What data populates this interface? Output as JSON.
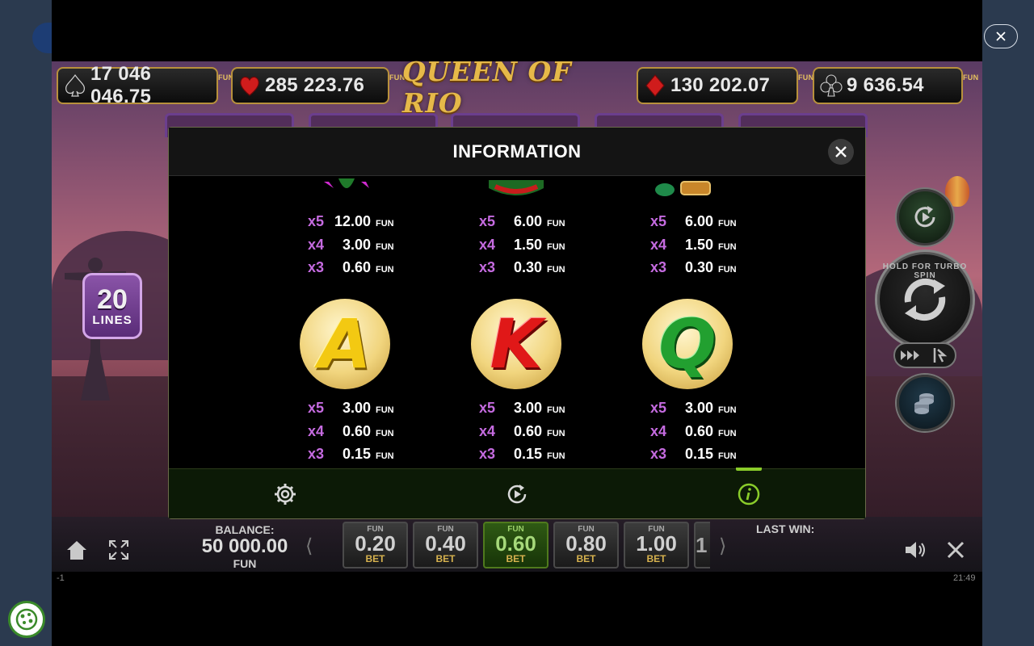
{
  "jackpots": [
    {
      "suit": "spade",
      "value": "17 046 046.75",
      "unit": "FUN"
    },
    {
      "suit": "heart",
      "value": "285 223.76",
      "unit": "FUN"
    },
    {
      "suit": "diamond",
      "value": "130 202.07",
      "unit": "FUN"
    },
    {
      "suit": "club",
      "value": "9 636.54",
      "unit": "FUN"
    }
  ],
  "logo": "QUEEN OF RIO",
  "lines": {
    "count": "20",
    "label": "LINES"
  },
  "dialog": {
    "title": "INFORMATION",
    "top_rows": [
      [
        {
          "m": "x5",
          "v": "12.00",
          "u": "FUN"
        },
        {
          "m": "x4",
          "v": "3.00",
          "u": "FUN"
        },
        {
          "m": "x3",
          "v": "0.60",
          "u": "FUN"
        }
      ],
      [
        {
          "m": "x5",
          "v": "6.00",
          "u": "FUN"
        },
        {
          "m": "x4",
          "v": "1.50",
          "u": "FUN"
        },
        {
          "m": "x3",
          "v": "0.30",
          "u": "FUN"
        }
      ],
      [
        {
          "m": "x5",
          "v": "6.00",
          "u": "FUN"
        },
        {
          "m": "x4",
          "v": "1.50",
          "u": "FUN"
        },
        {
          "m": "x3",
          "v": "0.30",
          "u": "FUN"
        }
      ]
    ],
    "symbols": [
      {
        "letter": "A",
        "pays": [
          {
            "m": "x5",
            "v": "3.00",
            "u": "FUN"
          },
          {
            "m": "x4",
            "v": "0.60",
            "u": "FUN"
          },
          {
            "m": "x3",
            "v": "0.15",
            "u": "FUN"
          }
        ]
      },
      {
        "letter": "K",
        "pays": [
          {
            "m": "x5",
            "v": "3.00",
            "u": "FUN"
          },
          {
            "m": "x4",
            "v": "0.60",
            "u": "FUN"
          },
          {
            "m": "x3",
            "v": "0.15",
            "u": "FUN"
          }
        ]
      },
      {
        "letter": "Q",
        "pays": [
          {
            "m": "x5",
            "v": "3.00",
            "u": "FUN"
          },
          {
            "m": "x4",
            "v": "0.60",
            "u": "FUN"
          },
          {
            "m": "x3",
            "v": "0.15",
            "u": "FUN"
          }
        ]
      }
    ],
    "tabs": [
      {
        "icon": "gear-icon",
        "active": false
      },
      {
        "icon": "replay-icon",
        "active": false
      },
      {
        "icon": "info-icon",
        "active": true
      }
    ]
  },
  "controls": {
    "spin_hint": "HOLD FOR TURBO SPIN"
  },
  "balance": {
    "label": "BALANCE:",
    "value": "50 000.00",
    "unit": "FUN"
  },
  "bets": [
    {
      "unit": "FUN",
      "value": "0.20",
      "label": "BET",
      "selected": false
    },
    {
      "unit": "FUN",
      "value": "0.40",
      "label": "BET",
      "selected": false
    },
    {
      "unit": "FUN",
      "value": "0.60",
      "label": "BET",
      "selected": true
    },
    {
      "unit": "FUN",
      "value": "0.80",
      "label": "BET",
      "selected": false
    },
    {
      "unit": "FUN",
      "value": "1.00",
      "label": "BET",
      "selected": false
    }
  ],
  "bet_partial": "1",
  "last_win": {
    "label": "LAST WIN:"
  },
  "footer": {
    "left": "-1",
    "time": "21:49"
  },
  "colors": {
    "accent_green": "#8acc2a",
    "multiplier": "#c56be0",
    "gold": "#e6b949"
  }
}
